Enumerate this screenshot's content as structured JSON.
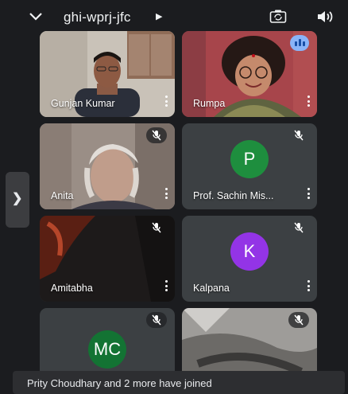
{
  "meeting": {
    "code": "ghi-wprj-jfc"
  },
  "icons": {
    "collapse": "chevron-down-icon",
    "info": "caret-right-icon",
    "camera": "camera-switch-icon",
    "audio": "speaker-icon",
    "mic_off": "mic-off-icon",
    "speaking": "audio-level-icon",
    "menu": "more-vert-icon",
    "sidebar": "chevron-right-icon"
  },
  "participants": [
    {
      "name": "Gunjan Kumar",
      "video": true,
      "muted": false
    },
    {
      "name": "Rumpa",
      "video": true,
      "speaking": true
    },
    {
      "name": "Anita",
      "video": true,
      "muted": true
    },
    {
      "name": "Prof. Sachin Mis...",
      "video": false,
      "initials": "P",
      "avatar_color": "#1e8e3e",
      "muted": true
    },
    {
      "name": "Amitabha",
      "video": true,
      "muted": true
    },
    {
      "name": "Kalpana",
      "video": false,
      "initials": "K",
      "avatar_color": "#9334e6",
      "muted": true
    },
    {
      "name": "",
      "video": false,
      "initials": "MC",
      "avatar_color": "#137333",
      "muted": true
    },
    {
      "name": "",
      "video": true,
      "muted": true
    }
  ],
  "toast": {
    "text": "Prity Choudhary and 2 more have joined"
  },
  "colors": {
    "background": "#1b1c1f",
    "tile": "#3c4043",
    "speaking_badge": "#8ab4f8"
  }
}
